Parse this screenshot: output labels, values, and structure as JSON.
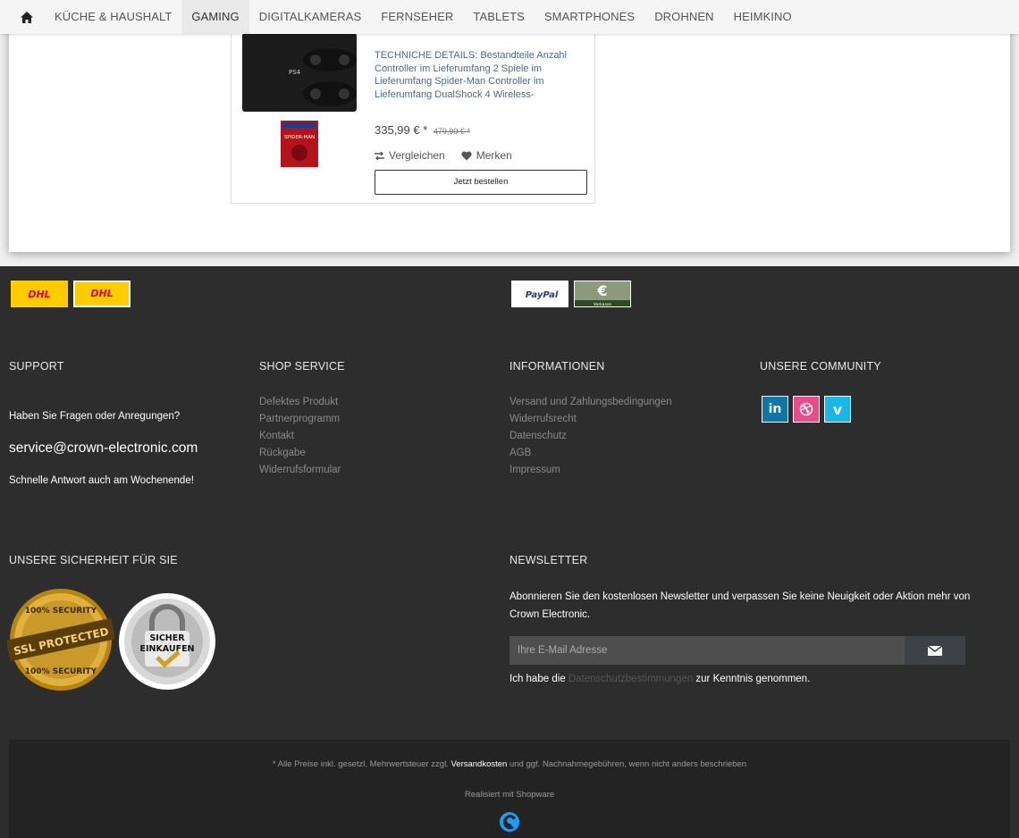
{
  "nav": {
    "home_icon": "home-icon",
    "items": [
      "KÜCHE & HAUSHALT",
      "GAMING",
      "DIGITALKAMERAS",
      "FERNSEHER",
      "TABLETS",
      "SMARTPHONES",
      "DROHNEN",
      "HEIMKINO"
    ],
    "active": "GAMING"
  },
  "product": {
    "description": "TECHNICHE DETAILS: Bestandteile Anzahl Controller im Lieferumfang 2 Spiele im Lieferumfang Spider-Man Controller im Lieferumfang DualShock 4 Wireless-",
    "price": "335,99 € *",
    "old_price": "479,99 € *",
    "compare_label": "Vergleichen",
    "remember_label": "Merken",
    "buy_label": "Jetzt bestellen",
    "game_cover_text": "SPIDER-MAN",
    "console_label": "PS4"
  },
  "footer": {
    "shipping_logos": [
      "DHL",
      "DHL"
    ],
    "payment_logos": [
      "PayPal",
      "Vorkasse"
    ],
    "support": {
      "heading": "SUPPORT",
      "question": "Haben Sie Fragen oder Anregungen?",
      "email": "service@crown-electronic.com",
      "note": "Schnelle Antwort auch am Wochenende!"
    },
    "shop_service": {
      "heading": "SHOP SERVICE",
      "links": [
        "Defektes Produkt",
        "Partnerprogramm",
        "Kontakt",
        "Rückgabe",
        "Widerrufsformular"
      ]
    },
    "informationen": {
      "heading": "INFORMATIONEN",
      "links": [
        "Versand und Zahlungsbedingungen",
        "Widerrufsrecht",
        "Datenschutz",
        "AGB",
        "Impressum"
      ]
    },
    "community": {
      "heading": "UNSERE COMMUNITY",
      "icons": [
        "linkedin-icon",
        "dribbble-icon",
        "vimeo-icon"
      ],
      "colors": [
        "#0e76a8",
        "#ea4c89",
        "#1ab7ea"
      ]
    },
    "security": {
      "heading": "UNSERE SICHERHEIT FÜR SIE",
      "badge1_top": "100% SECURITY",
      "badge1_main": "SSL PROTECTED",
      "badge1_bottom": "100% SECURITY",
      "badge2_line1": "SICHER",
      "badge2_line2": "EINKAUFEN"
    },
    "newsletter": {
      "heading": "NEWSLETTER",
      "text": "Abonnieren Sie den kostenlosen Newsletter und verpassen Sie keine Neuigkeit oder Aktion mehr von Crown Electronic.",
      "placeholder": "Ihre E-Mail Adresse",
      "consent_before": "Ich habe die ",
      "consent_link": "Datenschutzbestimmungen",
      "consent_after": " zur Kenntnis genommen."
    },
    "bottom": {
      "vat_before": "* Alle Preise inkl. gesetzl. Mehrwertsteuer zzgl. ",
      "vat_link": "Versandkosten",
      "vat_after": " und ggf. Nachnahmegebühren, wenn nicht anders beschrieben",
      "realized": "Realisiert mit Shopware"
    }
  }
}
